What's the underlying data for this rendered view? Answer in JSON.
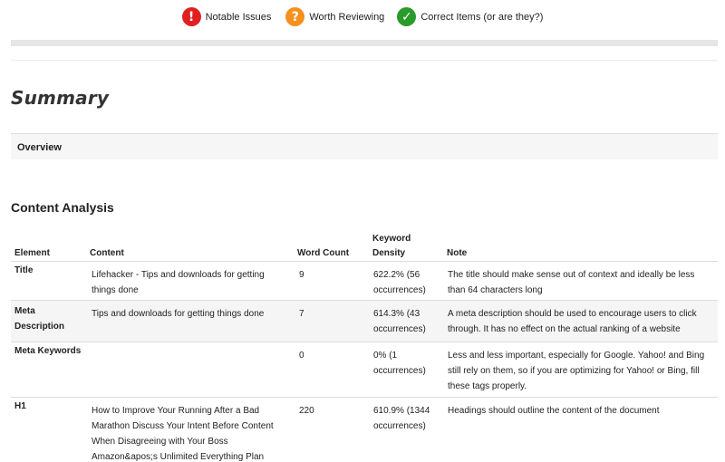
{
  "legend": {
    "items": [
      {
        "label": "Notable Issues",
        "glyph": "!",
        "color": "#e02020",
        "icon": "exclamation-icon"
      },
      {
        "label": "Worth Reviewing",
        "glyph": "?",
        "color": "#f5901e",
        "icon": "question-icon"
      },
      {
        "label": "Correct Items (or are they?)",
        "glyph": "✓",
        "color": "#2a9a2a",
        "icon": "checkmark-icon"
      }
    ]
  },
  "summary": {
    "title": "Summary"
  },
  "overview": {
    "label": "Overview"
  },
  "content_analysis": {
    "title": "Content Analysis",
    "headers": {
      "element": "Element",
      "content": "Content",
      "word_count": "Word Count",
      "keyword_density": "Keyword Density",
      "note": "Note"
    },
    "rows": [
      {
        "element": "Title",
        "content": "Lifehacker - Tips and downloads for getting things done",
        "word_count": "9",
        "keyword_density": "622.2% (56 occurrences)",
        "note": "The title should make sense out of context and ideally be less than 64 characters long"
      },
      {
        "element": "Meta Description",
        "content": "Tips and downloads for getting things done",
        "word_count": "7",
        "keyword_density": "614.3% (43 occurrences)",
        "note": "A meta description should be used to encourage users to click through. It has no effect on the actual ranking of a website"
      },
      {
        "element": "Meta Keywords",
        "content": "",
        "word_count": "0",
        "keyword_density": "0% (1 occurrences)",
        "note": "Less and less important, especially for Google. Yahoo! and Bing still rely on them, so if you are optimizing for Yahoo! or Bing, fill these tags properly."
      },
      {
        "element": "H1",
        "content": "How to Improve Your Running After a Bad Marathon Discuss Your Intent Before Content When Disagreeing with Your Boss Amazon&apos;s Unlimited Everything Plan Makes Cloud Storage",
        "word_count": "220",
        "keyword_density": "610.9% (1344 occurrences)",
        "note": "Headings should outline the content of the document"
      }
    ]
  }
}
